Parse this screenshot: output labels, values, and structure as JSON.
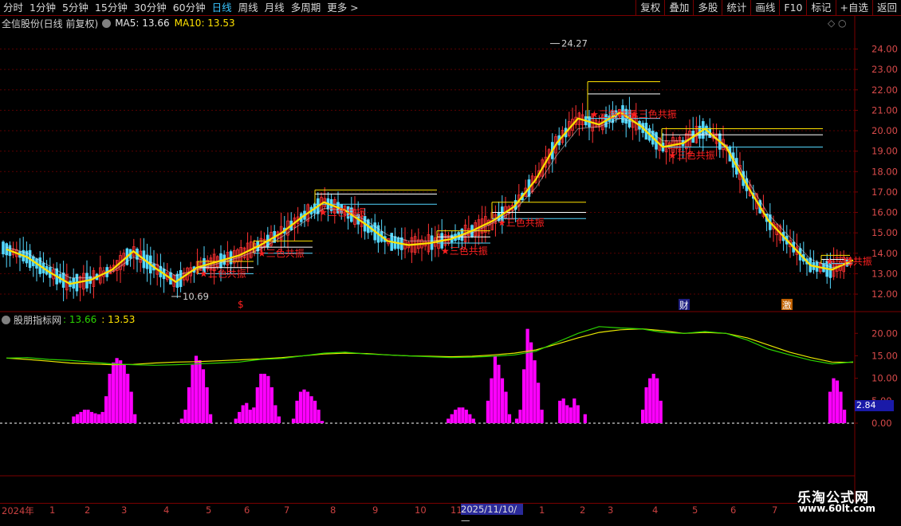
{
  "toolbar": {
    "periods": [
      "分时",
      "1分钟",
      "5分钟",
      "15分钟",
      "30分钟",
      "60分钟",
      "日线",
      "周线",
      "月线",
      "多周期",
      "更多 >"
    ],
    "active_period": "日线",
    "actions": [
      "复权",
      "叠加",
      "多股",
      "统计",
      "画线",
      "F10",
      "标记",
      "+自选",
      "返回"
    ]
  },
  "main_legend": {
    "stock": "全信股份(日线 前复权)",
    "ma5_label": "MA5: 13.66",
    "ma10_label": "MA10: 13.53"
  },
  "price_axis": [
    "24.00",
    "23.00",
    "22.00",
    "21.00",
    "20.00",
    "19.00",
    "18.00",
    "17.00",
    "16.00",
    "15.00",
    "14.00",
    "13.00",
    "12.00"
  ],
  "annotations": {
    "high_label": "24.27",
    "low_label": "10.69",
    "signal_text": "三色共振",
    "markers": [
      "$",
      "财",
      "激"
    ]
  },
  "indicator_legend": {
    "name": "股朋指标网",
    "v1": ": 13.66",
    "v2": ": 13.53"
  },
  "indicator_axis": [
    "20.00",
    "15.00",
    "10.00",
    "5.00",
    "0.00"
  ],
  "indicator_badge": "2.84",
  "date_axis": {
    "labels": [
      "2024年",
      "1",
      "2",
      "3",
      "4",
      "5",
      "6",
      "7",
      "8",
      "9",
      "10",
      "11",
      "1",
      "2",
      "3",
      "4",
      "5",
      "6",
      "7"
    ],
    "selected_date": "2025/11/10/—"
  },
  "watermark": {
    "title": "乐淘公式网",
    "url": "www.60lt.com"
  },
  "colors": {
    "up": "#ff3232",
    "down": "#54d8ff",
    "ma": "#ffe200",
    "signal_text": "#ff2020",
    "histogram": "#ff00ff",
    "line_green": "#2bd400",
    "line_yellow": "#e8e800",
    "frame": "#7a0000"
  },
  "chart_data": {
    "type": "line",
    "title": "全信股份(日线 前复权)",
    "ylim": [
      11.3,
      24.8
    ],
    "high": 24.27,
    "low": 10.69,
    "series": [
      {
        "name": "MA5",
        "values": [
          14.2,
          13.8,
          13.1,
          12.5,
          12.7,
          13.2,
          14.1,
          13.3,
          12.6,
          13.3,
          13.6,
          13.9,
          14.4,
          15.0,
          15.8,
          16.5,
          16.1,
          15.4,
          14.6,
          14.4,
          14.5,
          14.7,
          15.1,
          15.6,
          16.3,
          17.6,
          19.4,
          20.6,
          20.3,
          20.9,
          20.2,
          19.2,
          19.4,
          20.1,
          19.2,
          17.3,
          15.6,
          14.5,
          13.4,
          13.2,
          13.66
        ]
      },
      {
        "name": "MA10",
        "values": [
          14.3,
          14.0,
          13.4,
          12.8,
          12.8,
          13.1,
          13.8,
          13.5,
          12.9,
          13.2,
          13.5,
          13.8,
          14.2,
          14.8,
          15.5,
          16.2,
          16.1,
          15.6,
          14.9,
          14.6,
          14.6,
          14.7,
          15.0,
          15.5,
          16.1,
          17.2,
          18.8,
          20.1,
          20.2,
          20.6,
          20.3,
          19.5,
          19.5,
          19.9,
          19.3,
          17.6,
          15.9,
          14.8,
          13.7,
          13.3,
          13.53
        ]
      }
    ],
    "indicator": {
      "type": "area",
      "ylim": [
        0,
        22
      ],
      "histogram": [
        0,
        0,
        0,
        0,
        0,
        0,
        0,
        0,
        0,
        0,
        0,
        0,
        0,
        0,
        0,
        0,
        0,
        0,
        0,
        0,
        1.5,
        2,
        2.5,
        3,
        3,
        2.5,
        2.2,
        2,
        2.5,
        6,
        11,
        13.5,
        14.5,
        14,
        13,
        11,
        7,
        2,
        0,
        0,
        0,
        0,
        0,
        0,
        0,
        0,
        0,
        0,
        0,
        0,
        1,
        3,
        8,
        13,
        15,
        14,
        12,
        8,
        2,
        0,
        0,
        0,
        0,
        0,
        0,
        1,
        2.5,
        4,
        4.5,
        3,
        3.5,
        8,
        11,
        11,
        10.5,
        8,
        4,
        1.5,
        0,
        0,
        0,
        1,
        5,
        7,
        7.5,
        7,
        6,
        5,
        3,
        0.5,
        0,
        0,
        0,
        0,
        0,
        0,
        0,
        0,
        0,
        0,
        0,
        0,
        0,
        0,
        0,
        0,
        0,
        0,
        0,
        0,
        0,
        0,
        0,
        0,
        0,
        0,
        0,
        0,
        0,
        0,
        0,
        0,
        0,
        0,
        1,
        2,
        3,
        3.5,
        3.5,
        3,
        2,
        1,
        0,
        0,
        0,
        5,
        10,
        15,
        13,
        10,
        7,
        2,
        0,
        1,
        3,
        12,
        21,
        18,
        14,
        9,
        3,
        0,
        0,
        0,
        0,
        5,
        5.5,
        4,
        3.5,
        5.5,
        4,
        0,
        2,
        0,
        0,
        0,
        0,
        0,
        0,
        0,
        0,
        0,
        0,
        0,
        0,
        0,
        0,
        0,
        3,
        8,
        10,
        11,
        10,
        5,
        0,
        0,
        0,
        0,
        0,
        0,
        0,
        0,
        0,
        0,
        0,
        0,
        0,
        0,
        0,
        0,
        0,
        0,
        0,
        0,
        0,
        0,
        0,
        0,
        0,
        0,
        0,
        0,
        0,
        0,
        0,
        0,
        0,
        0,
        0,
        0,
        0,
        0,
        0,
        0,
        0,
        0,
        0,
        0,
        0,
        0,
        7,
        10,
        9.5,
        7,
        3,
        0
      ],
      "line1": [
        14.5,
        14.6,
        14.2,
        14.0,
        13.6,
        13.2,
        13.0,
        12.9,
        13.0,
        13.2,
        13.4,
        13.6,
        14.2,
        14.4,
        15.0,
        15.6,
        15.8,
        15.4,
        15.2,
        15.0,
        14.8,
        14.6,
        14.7,
        14.9,
        15.2,
        16.0,
        18.0,
        20.0,
        21.5,
        21.2,
        21.0,
        20.2,
        20.0,
        20.4,
        20.0,
        18.5,
        16.5,
        15.2,
        14.0,
        13.2,
        13.66
      ],
      "line2": [
        14.5,
        14.2,
        13.8,
        13.4,
        13.2,
        13.0,
        13.1,
        13.4,
        13.6,
        13.7,
        13.9,
        14.1,
        14.3,
        14.6,
        15.0,
        15.4,
        15.6,
        15.5,
        15.2,
        15.0,
        14.9,
        14.8,
        14.9,
        15.2,
        15.6,
        16.3,
        17.6,
        19.0,
        20.2,
        20.8,
        21.0,
        20.6,
        20.0,
        20.2,
        20.0,
        19.0,
        17.4,
        15.8,
        14.6,
        13.6,
        13.53
      ]
    }
  }
}
